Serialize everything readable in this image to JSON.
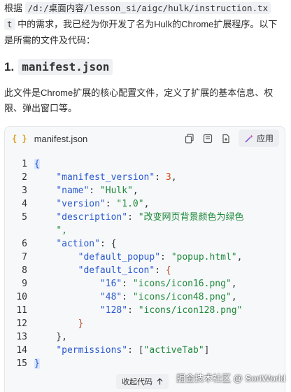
{
  "intro": {
    "prefix": "根据",
    "path_part1": "/d:/桌面内容/lesson_si/aigc/hulk/instruction.tx",
    "path_part2": "t",
    "after_path": "中的需求，我已经为你开发了名为Hulk的Chrome扩展程序。以下",
    "line3": "是所需的文件及代码："
  },
  "heading": {
    "number": "1.",
    "code": "manifest.json"
  },
  "description": {
    "line1": "此文件是Chrome扩展的核心配置文件，定义了扩展的基本信息、权",
    "line2": "限、弹出窗口等。"
  },
  "codeblock": {
    "file_icon": "{ }",
    "filename": "manifest.json",
    "apply_label": "应用",
    "icons": [
      "copy-icon",
      "insert-icon",
      "new-file-icon",
      "apply-wand-icon"
    ],
    "lines": [
      {
        "n": "1",
        "text": "{"
      },
      {
        "n": "2",
        "text": "    \"manifest_version\": 3,"
      },
      {
        "n": "3",
        "text": "    \"name\": \"Hulk\","
      },
      {
        "n": "4",
        "text": "    \"version\": \"1.0\","
      },
      {
        "n": "5",
        "text": "    \"description\": \"改变网页背景颜色为绿色"
      },
      {
        "n": "",
        "text": "    \","
      },
      {
        "n": "6",
        "text": "    \"action\": {"
      },
      {
        "n": "7",
        "text": "        \"default_popup\": \"popup.html\","
      },
      {
        "n": "8",
        "text": "        \"default_icon\": {"
      },
      {
        "n": "9",
        "text": "            \"16\": \"icons/icon16.png\","
      },
      {
        "n": "10",
        "text": "            \"48\": \"icons/icon48.png\","
      },
      {
        "n": "11",
        "text": "            \"128\": \"icons/icon128.png\""
      },
      {
        "n": "12",
        "text": "        }"
      },
      {
        "n": "13",
        "text": "    },"
      },
      {
        "n": "14",
        "text": "    \"permissions\": [\"activeTab\"]"
      },
      {
        "n": "15",
        "text": "}"
      }
    ]
  },
  "collapse": {
    "label": "收起代码",
    "icon": "arrow-up-icon"
  },
  "watermark": "掘金技术社区 @ SortWorld",
  "colors": {
    "key": "#2a5ad0",
    "string": "#1f8a3b",
    "number": "#d2491a",
    "file_icon": "#e0a123"
  }
}
